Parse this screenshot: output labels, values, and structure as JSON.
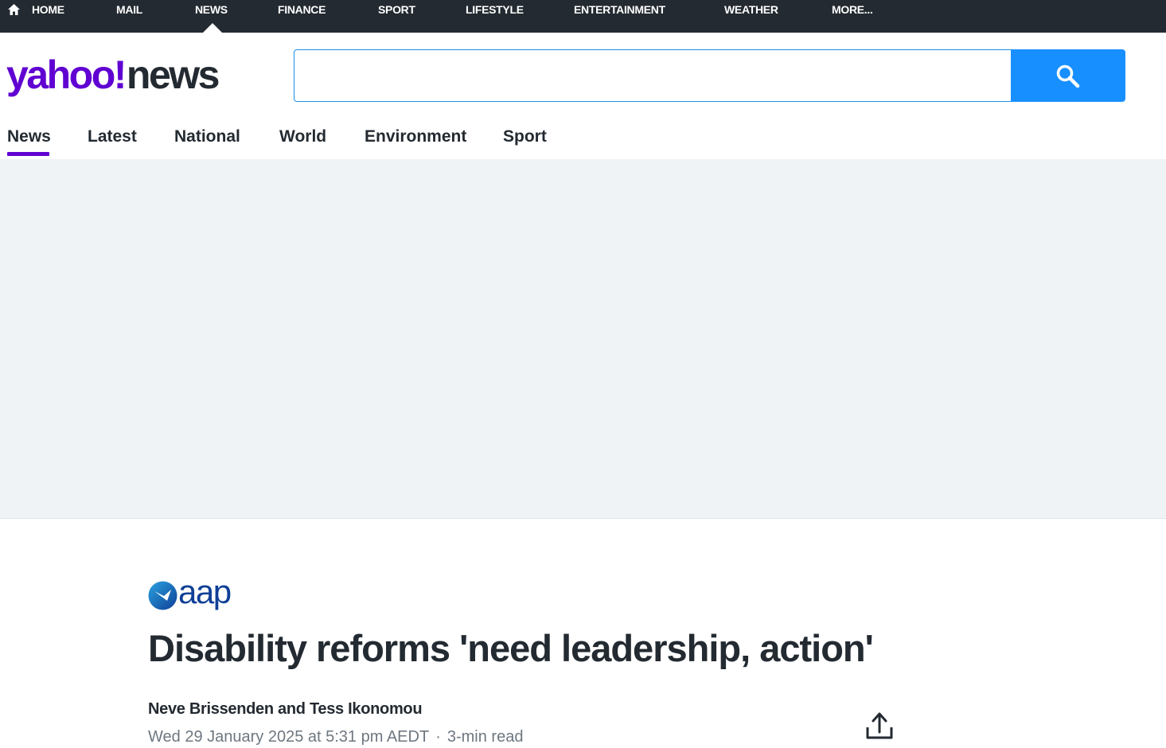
{
  "topnav": {
    "items": [
      "HOME",
      "MAIL",
      "NEWS",
      "FINANCE",
      "SPORT",
      "LIFESTYLE",
      "ENTERTAINMENT",
      "WEATHER",
      "MORE..."
    ],
    "active": "NEWS"
  },
  "header": {
    "logo_part1": "yahoo!",
    "logo_part2": "news",
    "search_placeholder": "",
    "search_value": ""
  },
  "subnav": {
    "tabs": [
      "News",
      "Latest",
      "National",
      "World",
      "Environment",
      "Sport"
    ],
    "active": "News"
  },
  "article": {
    "source": "aap",
    "headline": "Disability reforms 'need leadership, action'",
    "authors": "Neve Brissenden and Tess Ikonomou",
    "date": "Wed 29 January 2025 at 5:31 pm AEDT",
    "separator": "·",
    "read_time": "3-min read"
  },
  "colors": {
    "brand_purple": "#6001d2",
    "search_blue": "#188fff",
    "topnav_bg": "#232a31",
    "ad_bg": "#f0f3f5",
    "aap_blue": "#0e3f96"
  },
  "icons": [
    "home-icon",
    "search-icon",
    "share-icon",
    "aap-logo-mark"
  ]
}
